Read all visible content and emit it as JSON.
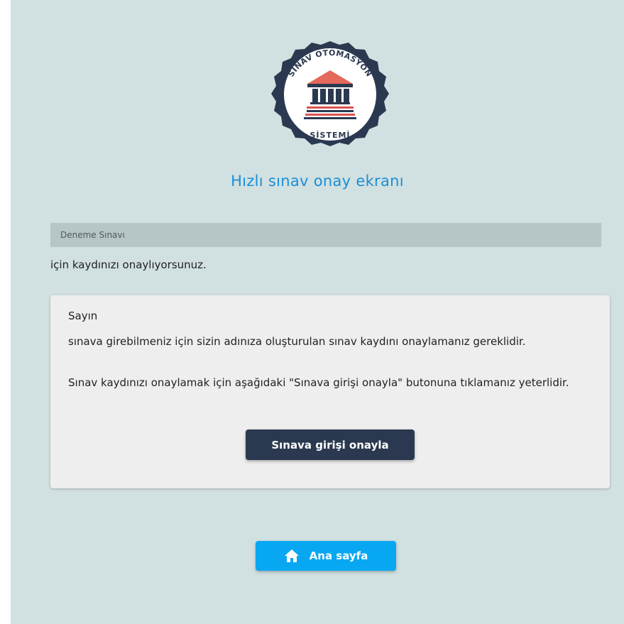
{
  "logo": {
    "top_text": "SINAV OTOMASYON",
    "bottom_text": "SİSTEMİ",
    "colors": {
      "badge": "#2b3950",
      "roof": "#e4685c",
      "stripe_red": "#d9534f",
      "navy": "#2b3950"
    }
  },
  "page_title": "Hızlı sınav onay ekranı",
  "exam_name": "Deneme Sınavı",
  "confirm_text": "için kaydınızı onaylıyorsunuz.",
  "card": {
    "salutation": "Sayın",
    "paragraph1": "sınava girebilmeniz için sizin adınıza oluşturulan sınav kaydını onaylamanız gereklidir.",
    "paragraph2": "Sınav kaydınızı onaylamak için aşağıdaki \"Sınava girişi onayla\" butonuna tıklamanız yeterlidir.",
    "button_label": "Sınava girişi onayla"
  },
  "home_button": {
    "label": "Ana sayfa",
    "icon": "home-icon"
  },
  "colors": {
    "background": "#d1e0e1",
    "title": "#1a8fd6",
    "primary_button": "#2b3950",
    "home_button": "#08a7f2"
  }
}
